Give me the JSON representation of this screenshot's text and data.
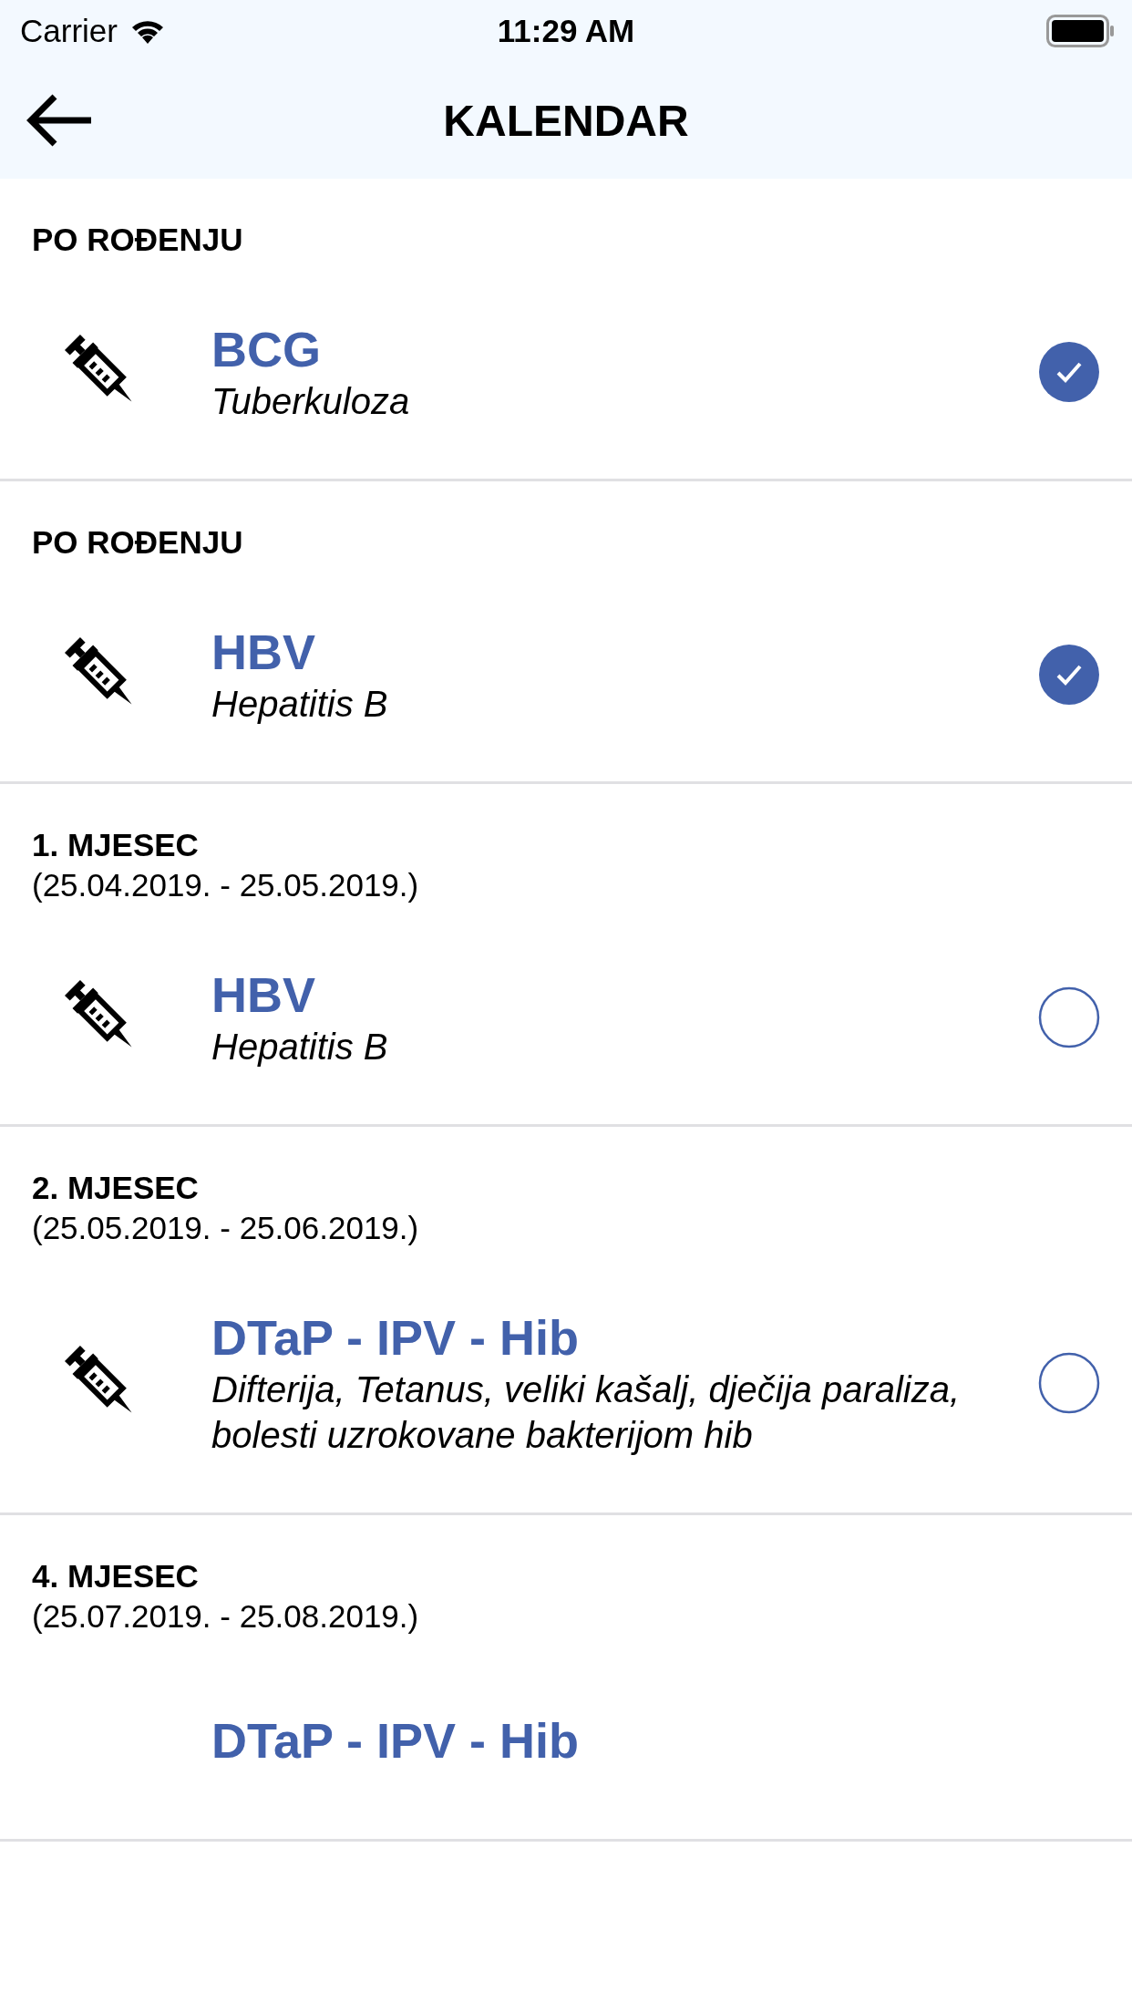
{
  "status_bar": {
    "carrier": "Carrier",
    "time": "11:29 AM"
  },
  "nav": {
    "title": "KALENDAR"
  },
  "sections": [
    {
      "heading": "PO ROĐENJU",
      "items": [
        {
          "name": "BCG",
          "description": "Tuberkuloza",
          "checked": true
        }
      ]
    },
    {
      "heading": "PO ROĐENJU",
      "items": [
        {
          "name": "HBV",
          "description": "Hepatitis B",
          "checked": true
        }
      ]
    },
    {
      "heading": "1. MJESEC",
      "dates": "(25.04.2019. - 25.05.2019.)",
      "items": [
        {
          "name": "HBV",
          "description": "Hepatitis B",
          "checked": false
        }
      ]
    },
    {
      "heading": "2. MJESEC",
      "dates": "(25.05.2019. - 25.06.2019.)",
      "items": [
        {
          "name": "DTaP - IPV - Hib",
          "description": "Difterija, Tetanus, veliki kašalj, dječija paraliza, bolesti uzrokovane bakterijom hib",
          "checked": false
        }
      ]
    },
    {
      "heading": "4. MJESEC",
      "dates": "(25.07.2019. - 25.08.2019.)",
      "items": [
        {
          "name": "DTaP - IPV - Hib"
        }
      ]
    }
  ]
}
